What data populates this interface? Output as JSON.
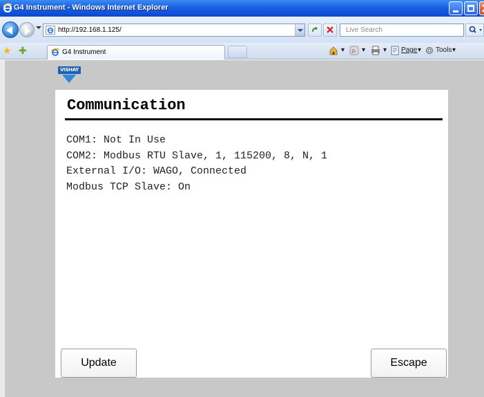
{
  "window": {
    "title": "G4 Instrument - Windows Internet Explorer"
  },
  "address_bar": {
    "url": "http://192.168.1.125/",
    "search_placeholder": "Live Search"
  },
  "tab_bar": {
    "tab_label": "G4 Instrument",
    "page_menu": "Page",
    "tools_menu": "Tools"
  },
  "page": {
    "logo_text": "VISHAY",
    "title": "Communication",
    "status_lines": [
      "COM1: Not In Use",
      "COM2: Modbus RTU Slave, 1, 115200, 8, N, 1",
      "External I/O: WAGO, Connected",
      "Modbus TCP Slave: On"
    ],
    "update_label": "Update",
    "escape_label": "Escape"
  },
  "colors": {
    "titlebar": "#1b5fe0",
    "content_background": "#c8c8c8",
    "panel": "#ffffff",
    "vishay_blue": "#1d5fb5"
  }
}
